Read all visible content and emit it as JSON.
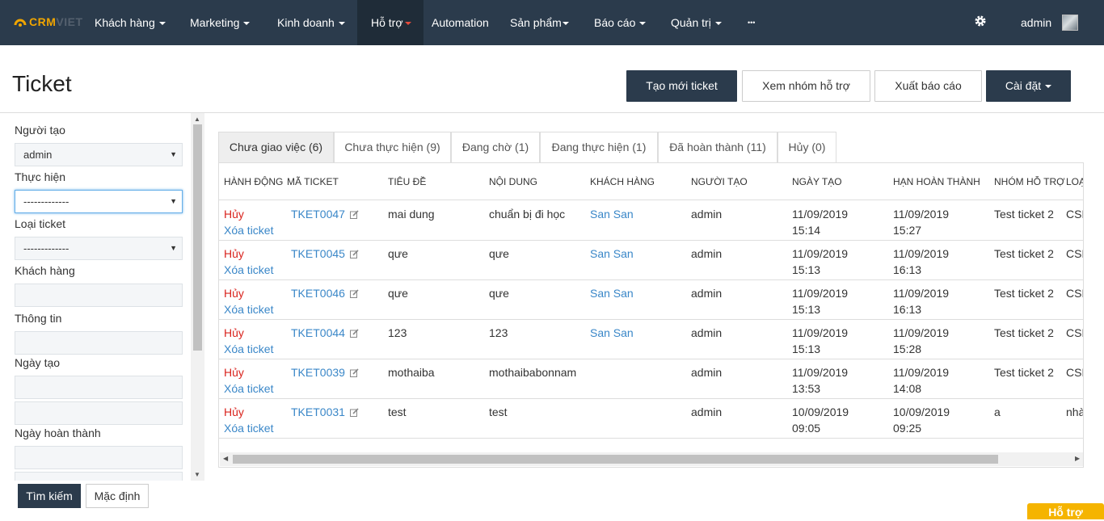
{
  "nav": {
    "logo_crm": "CRM",
    "logo_viet": "VIET",
    "items": [
      "Khách hàng",
      "Marketing",
      "Kinh doanh",
      "Hỗ trợ",
      "Automation",
      "Sản phẩm",
      "Báo cáo",
      "Quản trị",
      "•••"
    ],
    "active_index": 3,
    "user": "admin"
  },
  "page": {
    "title": "Ticket",
    "buttons": {
      "create": "Tạo mới ticket",
      "groups": "Xem nhóm hỗ trợ",
      "export": "Xuất báo cáo",
      "settings": "Cài đặt"
    }
  },
  "filters": {
    "creator_label": "Người tạo",
    "creator_value": "admin",
    "assignee_label": "Thực hiện",
    "assignee_value": "-------------",
    "type_label": "Loại ticket",
    "type_value": "-------------",
    "customer_label": "Khách hàng",
    "info_label": "Thông tin",
    "created_label": "Ngày tạo",
    "completed_label": "Ngày hoàn thành",
    "search_btn": "Tìm kiếm",
    "default_btn": "Mặc định"
  },
  "tabs": [
    "Chưa giao việc (6)",
    "Chưa thực hiện (9)",
    "Đang chờ (1)",
    "Đang thực hiện (1)",
    "Đã hoàn thành (11)",
    "Hủy (0)"
  ],
  "table": {
    "headers": [
      "Hành động",
      "Mã ticket",
      "Tiêu đề",
      "Nội dung",
      "Khách hàng",
      "Người tạo",
      "Ngày tạo",
      "Hạn hoàn thành",
      "Nhóm hỗ trợ",
      "Loại"
    ],
    "action_cancel": "Hủy",
    "action_delete": "Xóa ticket",
    "rows": [
      {
        "code": "TKET0047",
        "title": "mai dung",
        "content": "chuẩn bị đi học",
        "customer": "San San",
        "creator": "admin",
        "created_date": "11/09/2019",
        "created_time": "15:14",
        "due_date": "11/09/2019",
        "due_time": "15:27",
        "group": "Test ticket 2",
        "type": "CSK"
      },
      {
        "code": "TKET0045",
        "title": "qưe",
        "content": "qưe",
        "customer": "San San",
        "creator": "admin",
        "created_date": "11/09/2019",
        "created_time": "15:13",
        "due_date": "11/09/2019",
        "due_time": "16:13",
        "group": "Test ticket 2",
        "type": "CSK"
      },
      {
        "code": "TKET0046",
        "title": "qưe",
        "content": "qưe",
        "customer": "San San",
        "creator": "admin",
        "created_date": "11/09/2019",
        "created_time": "15:13",
        "due_date": "11/09/2019",
        "due_time": "16:13",
        "group": "Test ticket 2",
        "type": "CSK"
      },
      {
        "code": "TKET0044",
        "title": "123",
        "content": "123",
        "customer": "San San",
        "creator": "admin",
        "created_date": "11/09/2019",
        "created_time": "15:13",
        "due_date": "11/09/2019",
        "due_time": "15:28",
        "group": "Test ticket 2",
        "type": "CSK"
      },
      {
        "code": "TKET0039",
        "title": "mothaiba",
        "content": "mothaibabonnam",
        "customer": "",
        "creator": "admin",
        "created_date": "11/09/2019",
        "created_time": "13:53",
        "due_date": "11/09/2019",
        "due_time": "14:08",
        "group": "Test ticket 2",
        "type": "CSK"
      },
      {
        "code": "TKET0031",
        "title": "test",
        "content": "test",
        "customer": "",
        "creator": "admin",
        "created_date": "10/09/2019",
        "created_time": "09:05",
        "due_date": "10/09/2019",
        "due_time": "09:25",
        "group": "a",
        "type": "nhà"
      }
    ]
  },
  "help_button": "Hỗ trợ",
  "colors": {
    "nav_bg": "#2b3b4c",
    "accent_orange": "#f0a500",
    "link_blue": "#3a87c8",
    "cancel_red": "#d9241e",
    "help_yellow": "#f5b400"
  }
}
